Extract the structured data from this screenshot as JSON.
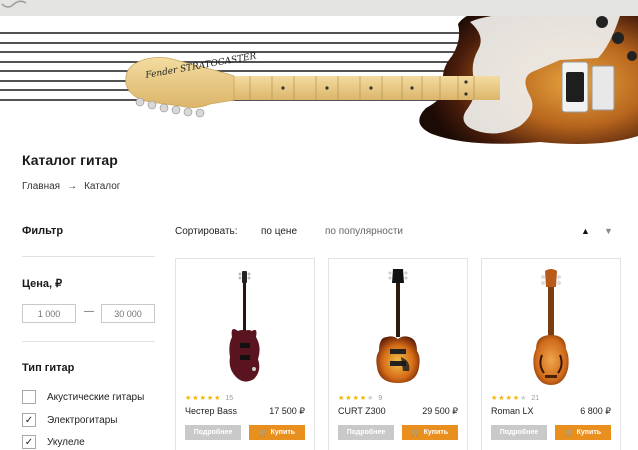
{
  "page": {
    "title": "Каталог гитар",
    "breadcrumb": {
      "home": "Главная",
      "separator": "→",
      "current": "Каталог"
    }
  },
  "hero": {
    "headstock_brand": "Fender STRATOCASTER"
  },
  "filter": {
    "title": "Фильтр",
    "price": {
      "title": "Цена, ₽",
      "min_placeholder": "1 000",
      "max_placeholder": "30 000",
      "dash": "—"
    },
    "type": {
      "title": "Тип гитар",
      "options": [
        {
          "label": "Акустические гитары",
          "checked": false
        },
        {
          "label": "Электрогитары",
          "checked": true
        },
        {
          "label": "Укулеле",
          "checked": true
        }
      ]
    }
  },
  "sort": {
    "label": "Сортировать:",
    "by_price": "по цене",
    "by_popularity": "по популярности",
    "up": "▲",
    "down": "▼"
  },
  "products": [
    {
      "name": "Честер Bass",
      "price": "17 500 ₽",
      "rating": 4.5,
      "reviews": "15",
      "details": "Подробнее",
      "buy": "Купить",
      "image": "electric-guitar-maroon"
    },
    {
      "name": "CURT Z300",
      "price": "29 500 ₽",
      "rating": 3.5,
      "reviews": "9",
      "details": "Подробнее",
      "buy": "Купить",
      "image": "electric-guitar-sunburst"
    },
    {
      "name": "Roman LX",
      "price": "6 800 ₽",
      "rating": 4,
      "reviews": "21",
      "details": "Подробнее",
      "buy": "Купить",
      "image": "ukulele"
    }
  ],
  "colors": {
    "accent": "#e98f1e",
    "muted_button": "#c9c9c9",
    "star": "#f4b400"
  }
}
